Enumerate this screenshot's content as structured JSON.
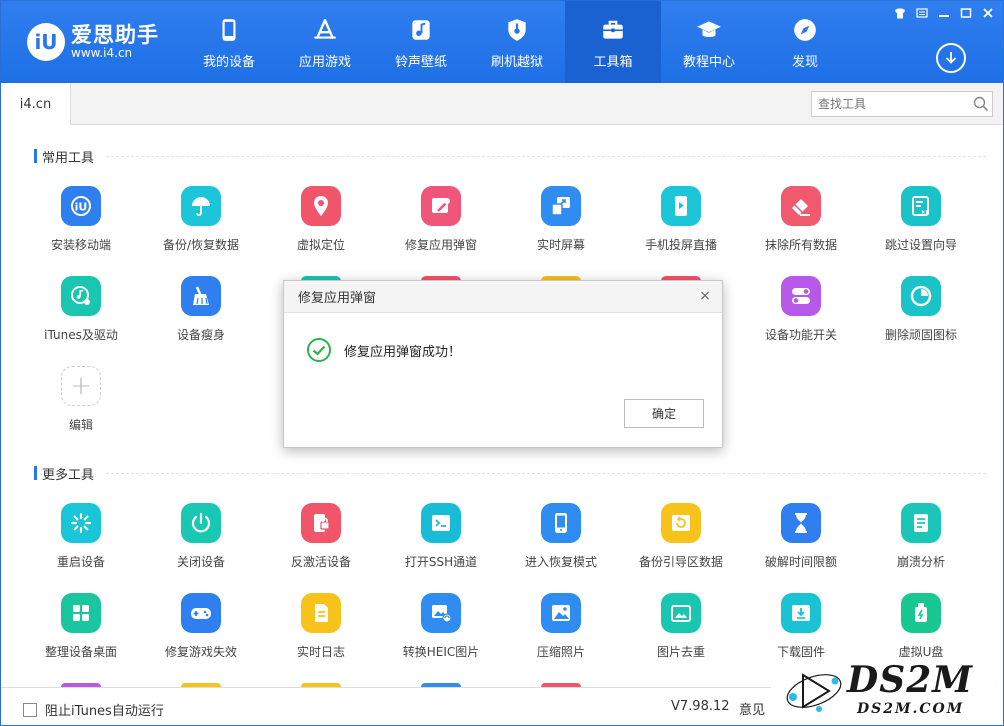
{
  "brand": {
    "mark": "iU",
    "name": "爱思助手",
    "url": "www.i4.cn",
    "accent": "#2a76ee"
  },
  "nav": [
    {
      "label": "我的设备",
      "icon": "phone-icon"
    },
    {
      "label": "应用游戏",
      "icon": "app-store-icon"
    },
    {
      "label": "铃声壁纸",
      "icon": "music-note-icon"
    },
    {
      "label": "刷机越狱",
      "icon": "shield-icon"
    },
    {
      "label": "工具箱",
      "icon": "toolbox-icon",
      "active": true
    },
    {
      "label": "教程中心",
      "icon": "graduation-cap-icon"
    },
    {
      "label": "发现",
      "icon": "compass-icon"
    }
  ],
  "tab": {
    "label": "i4.cn"
  },
  "search": {
    "placeholder": "查找工具"
  },
  "sections": {
    "common": "常用工具",
    "more": "更多工具"
  },
  "common_tools": [
    {
      "label": "安装移动端",
      "color": "#2f7ff0"
    },
    {
      "label": "备份/恢复数据",
      "color": "#1cc6d8"
    },
    {
      "label": "虚拟定位",
      "color": "#f0556a"
    },
    {
      "label": "修复应用弹窗",
      "color": "#f0557a"
    },
    {
      "label": "实时屏幕",
      "color": "#2f8cf0"
    },
    {
      "label": "手机投屏直播",
      "color": "#1cc6d8"
    },
    {
      "label": "抹除所有数据",
      "color": "#f05a6e"
    },
    {
      "label": "跳过设置向导",
      "color": "#19c3c7"
    },
    {
      "label": "iTunes及驱动",
      "color": "#19c6b0"
    },
    {
      "label": "设备瘦身",
      "color": "#2f7ff0"
    },
    {
      "label": "设备功能开关",
      "color": "#b658e8"
    },
    {
      "label": "删除顽固图标",
      "color": "#19c3c7"
    },
    {
      "label": "编辑",
      "color": "#ffffff"
    }
  ],
  "more_tools": [
    {
      "label": "重启设备",
      "color": "#19c6d8"
    },
    {
      "label": "关闭设备",
      "color": "#19c8b2"
    },
    {
      "label": "反激活设备",
      "color": "#f0556a"
    },
    {
      "label": "打开SSH通道",
      "color": "#19bcd6"
    },
    {
      "label": "进入恢复模式",
      "color": "#2f8cf0"
    },
    {
      "label": "备份引导区数据",
      "color": "#f7c21a"
    },
    {
      "label": "破解时间限额",
      "color": "#2f7ff0"
    },
    {
      "label": "崩溃分析",
      "color": "#19c6b8"
    },
    {
      "label": "整理设备桌面",
      "color": "#19c6a0"
    },
    {
      "label": "修复游戏失效",
      "color": "#2f7ff0"
    },
    {
      "label": "实时日志",
      "color": "#f7c21a"
    },
    {
      "label": "转换HEIC图片",
      "color": "#2f8cf0"
    },
    {
      "label": "压缩照片",
      "color": "#2f8cf0"
    },
    {
      "label": "图片去重",
      "color": "#19c6b0"
    },
    {
      "label": "下载固件",
      "color": "#19c3d3"
    },
    {
      "label": "虚拟U盘",
      "color": "#19c890"
    }
  ],
  "dialog": {
    "title": "修复应用弹窗",
    "message": "修复应用弹窗成功！",
    "ok": "确定",
    "close": "×"
  },
  "bottom": {
    "checkbox": "阻止iTunes自动运行",
    "version": "V7.98.12",
    "feedback": "意见"
  },
  "watermark": {
    "big": "DS2M",
    "small": "DS2M.COM"
  }
}
